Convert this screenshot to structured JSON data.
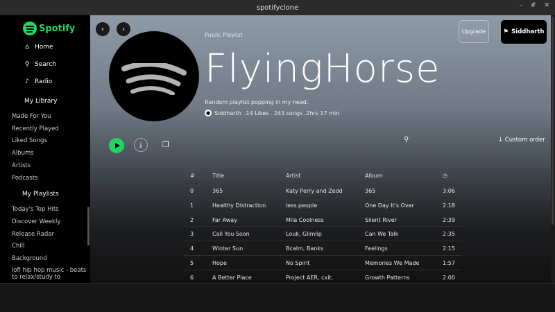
{
  "window": {
    "title": "spotifyclone",
    "controls": [
      "–",
      "#",
      "✕"
    ]
  },
  "sidebar": {
    "logo_text": "Spotify",
    "nav": [
      {
        "label": "Home",
        "icon": "home-icon",
        "glyph": "⌂"
      },
      {
        "label": "Search",
        "icon": "search-icon",
        "glyph": "⚲"
      },
      {
        "label": "Radio",
        "icon": "music-note-icon",
        "glyph": "♪"
      }
    ],
    "library_title": "My Library",
    "library": [
      "Made For You",
      "Recently Played",
      "Liked Songs",
      "Albums",
      "Artists",
      "Podcasts"
    ],
    "playlists_title": "My Playlists",
    "playlists": [
      "Today's Top Hits",
      "Discover Weekly",
      "Release Radar",
      "Chill",
      "Background",
      "lofi hip hop music - beats",
      "to relax/study to"
    ]
  },
  "header": {
    "back_glyph": "‹",
    "forward_glyph": "›",
    "upgrade_label": "Upgrade",
    "user_label": "Siddharth",
    "user_icon_glyph": "⚑"
  },
  "playlist": {
    "type": "Public Playlist",
    "title": "FlyingHorse",
    "description": "Random playlist popping in my head.",
    "owner": "Siddharth",
    "meta": ".14 Likes . 243 songs .2hrs 17 min"
  },
  "actions": {
    "download_glyph": "⤓",
    "copy_glyph": "❐",
    "search_glyph": "⚲",
    "sort_label": "↓  Custom order"
  },
  "table": {
    "headers": [
      "#",
      "Title",
      "Artist",
      "Album",
      "◷"
    ],
    "rows": [
      [
        "0",
        "365",
        "Katy Perry and Zedd",
        "365",
        "3:06"
      ],
      [
        "1",
        "Healthy Distraction",
        "less.people",
        "One Day It's Over",
        "2:18"
      ],
      [
        "2",
        "Far Away",
        "Mila Coolness",
        "Silent River",
        "2:39"
      ],
      [
        "3",
        "Call You Soon",
        "Louk, Glimlip",
        "Can We Talk",
        "2:35"
      ],
      [
        "4",
        "Winter Sun",
        "Bcalm, Banks",
        "Feelings",
        "2:15"
      ],
      [
        "5",
        "Hope",
        "No Spirit",
        "Memories We Made",
        "1:57"
      ],
      [
        "6",
        "A Better Place",
        "Project AER, cxit.",
        "Growth Patterns",
        "2:00"
      ]
    ]
  },
  "colors": {
    "accent": "#1ed760",
    "sidebar_bg": "#000000",
    "main_bg": "#121212"
  }
}
